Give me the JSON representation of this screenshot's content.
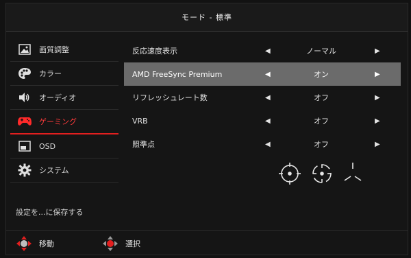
{
  "header": {
    "title": "モード - 標準"
  },
  "sidebar": {
    "items": [
      {
        "label": "画質調整",
        "icon": "picture-icon"
      },
      {
        "label": "カラー",
        "icon": "palette-icon"
      },
      {
        "label": "オーディオ",
        "icon": "speaker-icon"
      },
      {
        "label": "ゲーミング",
        "icon": "gamepad-icon",
        "active": true
      },
      {
        "label": "OSD",
        "icon": "osd-icon"
      },
      {
        "label": "システム",
        "icon": "gear-icon"
      }
    ]
  },
  "settings": [
    {
      "label": "反応速度表示",
      "value": "ノーマル"
    },
    {
      "label": "AMD FreeSync Premium",
      "value": "オン",
      "highlighted": true
    },
    {
      "label": "リフレッシュレート数",
      "value": "オフ"
    },
    {
      "label": "VRB",
      "value": "オフ"
    },
    {
      "label": "照準点",
      "value": "オフ"
    }
  ],
  "crosshair_options": [
    "crosshair-circle-icon",
    "crosshair-dashed-icon",
    "crosshair-y-icon"
  ],
  "save_text": "設定を...に保存する",
  "footer": {
    "move_label": "移動",
    "select_label": "選択"
  },
  "colors": {
    "accent": "#e21f1f",
    "highlight": "#6b6b6b",
    "background": "#151515"
  }
}
